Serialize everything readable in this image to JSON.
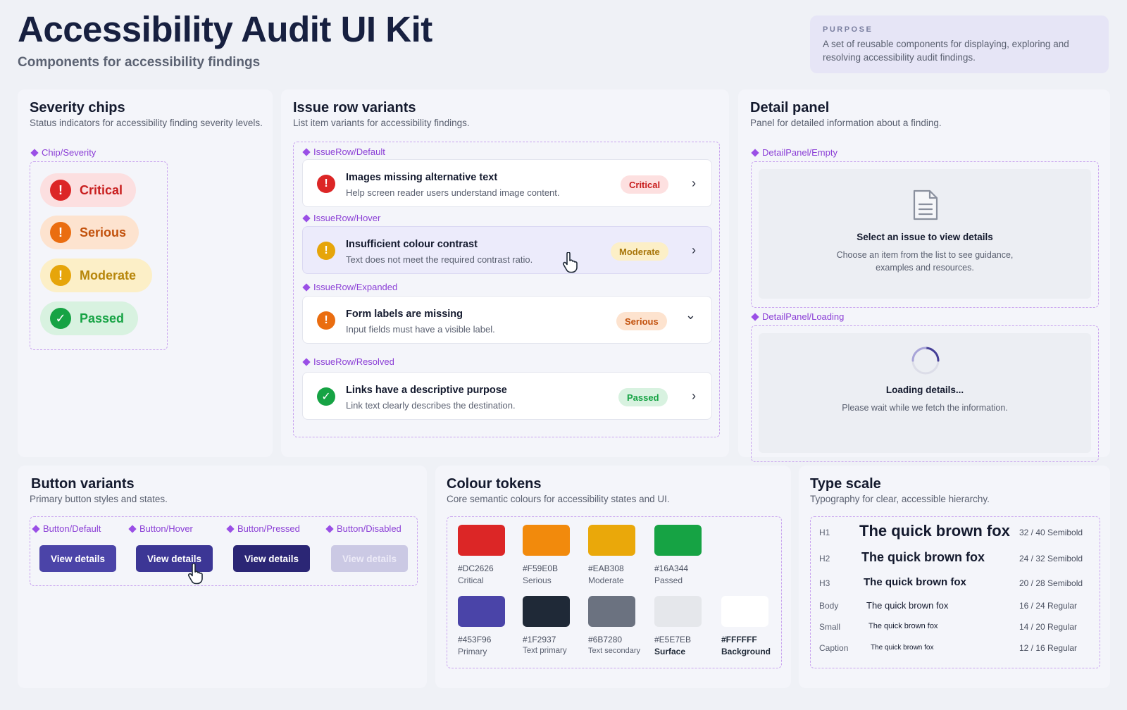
{
  "header": {
    "title": "Accessibility Audit UI Kit",
    "subtitle": "Components for accessibility findings",
    "purpose_label": "PURPOSE",
    "purpose_text": "A set of reusable components for displaying, exploring and resolving accessibility audit findings."
  },
  "severity": {
    "title": "Severity chips",
    "subtitle": "Status indicators for accessibility finding severity levels.",
    "variant_label": "Chip/Severity",
    "chips": [
      {
        "label": "Critical",
        "icon": "!",
        "icon_name": "exclamation-icon"
      },
      {
        "label": "Serious",
        "icon": "!",
        "icon_name": "exclamation-icon"
      },
      {
        "label": "Moderate",
        "icon": "!",
        "icon_name": "exclamation-icon"
      },
      {
        "label": "Passed",
        "icon": "✓",
        "icon_name": "check-icon"
      }
    ]
  },
  "issues": {
    "title": "Issue row variants",
    "subtitle": "List item variants for accessibility findings.",
    "rows": [
      {
        "variant": "IssueRow/Default",
        "title": "Images missing alternative text",
        "desc": "Help screen reader users understand image content.",
        "badge": "Critical",
        "icon": "!",
        "chevron": "›"
      },
      {
        "variant": "IssueRow/Hover",
        "title": "Insufficient colour contrast",
        "desc": "Text does not meet the required contrast ratio.",
        "badge": "Moderate",
        "icon": "!",
        "chevron": "›"
      },
      {
        "variant": "IssueRow/Expanded",
        "title": "Form labels are missing",
        "desc": "Input fields must have a visible label.",
        "badge": "Serious",
        "icon": "!",
        "chevron": "⌄"
      },
      {
        "variant": "IssueRow/Resolved",
        "title": "Links have a descriptive purpose",
        "desc": "Link text clearly describes the destination.",
        "badge": "Passed",
        "icon": "✓",
        "chevron": "›"
      }
    ]
  },
  "detail": {
    "title": "Detail panel",
    "subtitle": "Panel for detailed information about a finding.",
    "empty": {
      "variant": "DetailPanel/Empty",
      "title": "Select an issue to view details",
      "text_line1": "Choose an item from the list to see guidance,",
      "text_line2": "examples and resources.",
      "icon": "document-icon"
    },
    "loading": {
      "variant": "DetailPanel/Loading",
      "title": "Loading details...",
      "text": "Please wait while we fetch the information.",
      "icon": "spinner-icon"
    }
  },
  "buttons": {
    "title": "Button variants",
    "subtitle": "Primary button styles and states.",
    "items": [
      {
        "variant": "Button/Default",
        "label": "View details"
      },
      {
        "variant": "Button/Hover",
        "label": "View details"
      },
      {
        "variant": "Button/Pressed",
        "label": "View details"
      },
      {
        "variant": "Button/Disabled",
        "label": "View details"
      }
    ]
  },
  "tokens": {
    "title": "Colour tokens",
    "subtitle": "Core semantic colours for accessibility states and UI.",
    "items": [
      {
        "hex": "#DC2626",
        "name": "Critical"
      },
      {
        "hex": "#F59E0B",
        "name": "Serious"
      },
      {
        "hex": "#EAB308",
        "name": "Moderate"
      },
      {
        "hex": "#16A344",
        "name": "Passed"
      },
      {
        "hex": "#453F96",
        "name": "Primary"
      },
      {
        "hex": "#1F2937",
        "name": "Text primary"
      },
      {
        "hex": "#6B7280",
        "name": "Text secondary"
      },
      {
        "hex": "#E5E7EB",
        "name": "Surface"
      },
      {
        "hex": "#FFFFFF",
        "name": "Background"
      }
    ]
  },
  "type_scale": {
    "title": "Type scale",
    "subtitle": "Typography for clear, accessible hierarchy.",
    "items": [
      {
        "label": "H1",
        "sample": "The quick brown fox",
        "spec": "32 / 40 Semibold"
      },
      {
        "label": "H2",
        "sample": "The quick brown fox",
        "spec": "24 / 32 Semibold"
      },
      {
        "label": "H3",
        "sample": "The quick brown fox",
        "spec": "20 / 28 Semibold"
      },
      {
        "label": "Body",
        "sample": "The quick brown fox",
        "spec": "16 / 24 Regular"
      },
      {
        "label": "Small",
        "sample": "The quick brown fox",
        "spec": "14 / 20 Regular"
      },
      {
        "label": "Caption",
        "sample": "The quick brown fox",
        "spec": "12 / 16 Regular"
      }
    ]
  },
  "colors": {
    "critical": "#DC2626",
    "serious": "#F59E0B",
    "moderate": "#EAB308",
    "passed": "#16A344",
    "primary": "#453F96"
  }
}
